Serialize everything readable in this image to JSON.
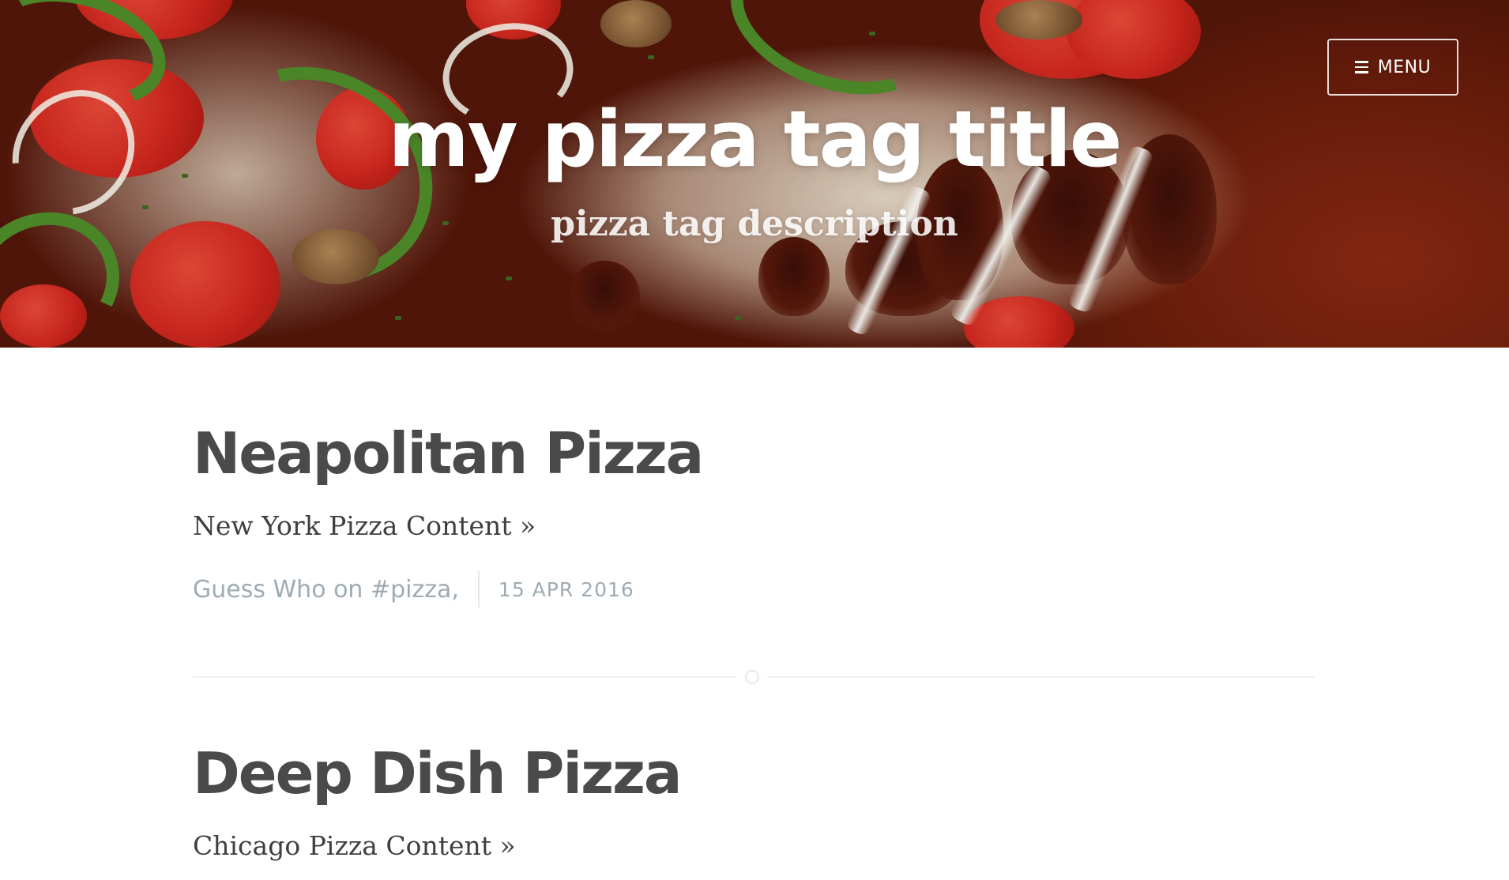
{
  "header": {
    "title": "my pizza tag title",
    "description": "pizza tag description",
    "menu_label": "MENU",
    "menu_icon": "hamburger-icon"
  },
  "posts": [
    {
      "title": "Neapolitan Pizza",
      "excerpt": "New York Pizza Content »",
      "author_line": "Guess Who on #pizza,",
      "date": "15 APR 2016"
    },
    {
      "title": "Deep Dish Pizza",
      "excerpt": "Chicago Pizza Content »"
    }
  ],
  "colors": {
    "text_dark": "#4a4a4a",
    "meta_gray": "#9eabb3",
    "divider": "#ebf0f2",
    "header_text": "#ffffff"
  }
}
